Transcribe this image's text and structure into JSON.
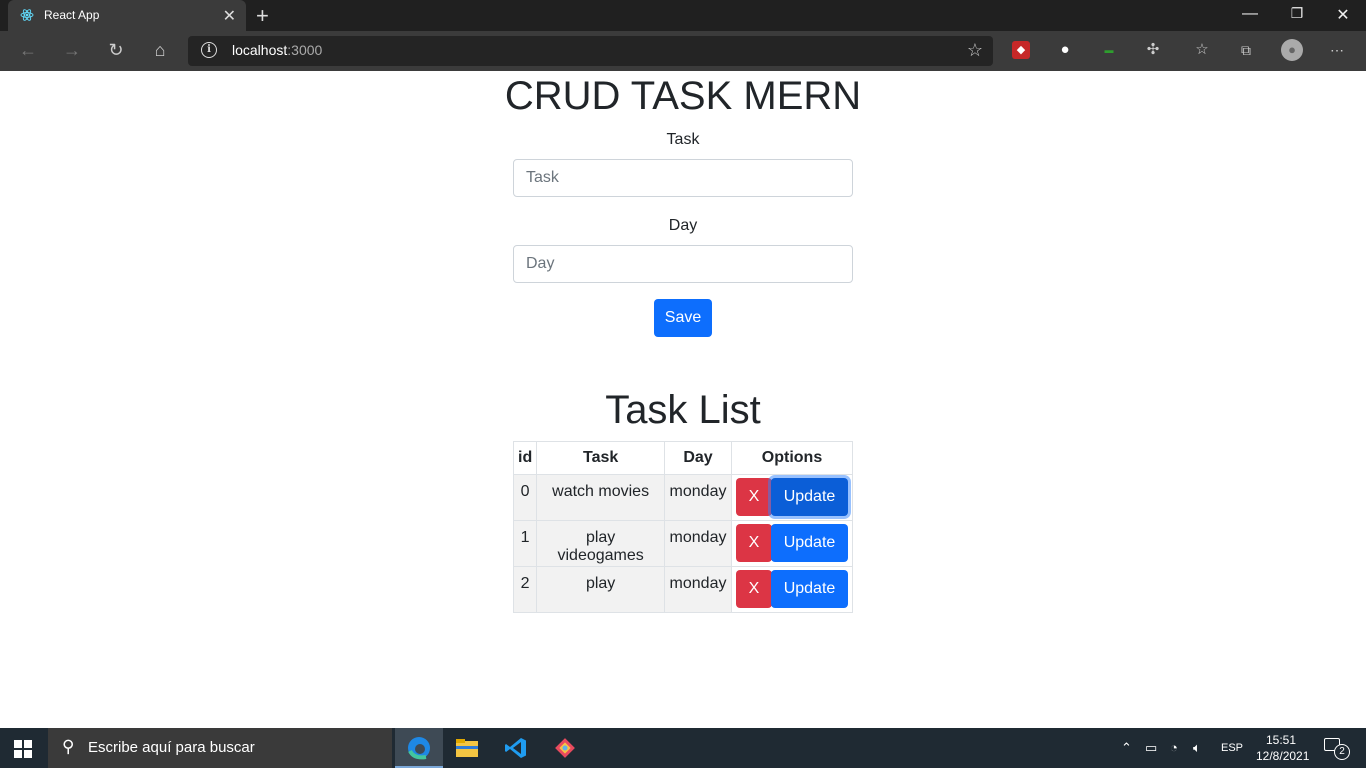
{
  "browser": {
    "tab_title": "React App",
    "url_host": "localhost",
    "url_port": ":3000"
  },
  "page": {
    "title": "CRUD TASK MERN",
    "task_label": "Task",
    "task_placeholder": "Task",
    "day_label": "Day",
    "day_placeholder": "Day",
    "save_label": "Save",
    "list_title": "Task List"
  },
  "table": {
    "headers": [
      "id",
      "Task",
      "Day",
      "Options"
    ],
    "rows": [
      {
        "id": "0",
        "task": "watch movies",
        "day": "monday",
        "delete_label": "X",
        "update_label": "Update"
      },
      {
        "id": "1",
        "task": "play videogames",
        "day": "monday",
        "delete_label": "X",
        "update_label": "Update"
      },
      {
        "id": "2",
        "task": "play",
        "day": "monday",
        "delete_label": "X",
        "update_label": "Update"
      }
    ]
  },
  "taskbar": {
    "search_placeholder": "Escribe aquí para buscar",
    "language": "ESP",
    "time": "15:51",
    "date": "12/8/2021",
    "notification_count": "2"
  },
  "colors": {
    "primary": "#0d6efd",
    "danger": "#dc3545"
  }
}
